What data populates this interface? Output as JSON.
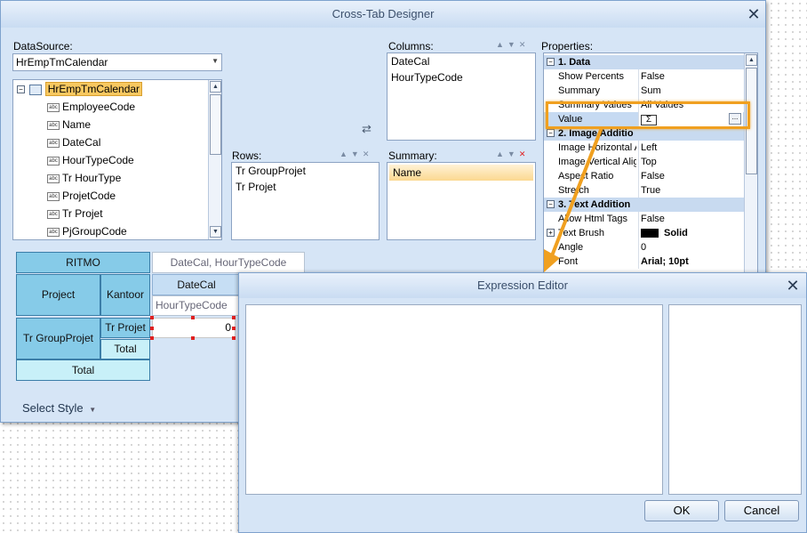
{
  "designer": {
    "title": "Cross-Tab Designer",
    "datasource_label": "DataSource:",
    "datasource_value": "HrEmpTmCalendar",
    "tree": {
      "root": "HrEmpTmCalendar",
      "fields": [
        "EmployeeCode",
        "Name",
        "DateCal",
        "HourTypeCode",
        "Tr HourType",
        "ProjetCode",
        "Tr Projet",
        "PjGroupCode"
      ]
    },
    "columns_label": "Columns:",
    "columns": [
      "DateCal",
      "HourTypeCode"
    ],
    "rows_label": "Rows:",
    "rows": [
      "Tr GroupProjet",
      "Tr Projet"
    ],
    "summary_label": "Summary:",
    "summary": [
      "Name"
    ],
    "properties_label": "Properties:",
    "select_style": "Select Style",
    "preview": {
      "title_cell": "RITMO",
      "header_cols": "DateCal, HourTypeCode",
      "col1": "Project",
      "col2": "Kantoor",
      "datecal": "DateCal",
      "hourtype": "HourTypeCode",
      "group": "Tr GroupProjet",
      "projet": "Tr Projet",
      "value": "0",
      "total_inner": "Total",
      "total_outer": "Total"
    }
  },
  "properties": {
    "cat1": "1. Data",
    "show_percents_name": "Show Percents",
    "show_percents_value": "False",
    "summary_name": "Summary",
    "summary_value": "Sum",
    "summary_values_name": "Summary Values",
    "summary_values_value": "All Values",
    "value_name": "Value",
    "value_value": "Σ",
    "cat2": "2. Image Additio",
    "img_h_name": "Image Horizontal A",
    "img_h_value": "Left",
    "img_v_name": "Image Vertical Alig",
    "img_v_value": "Top",
    "aspect_name": "Aspect Ratio",
    "aspect_value": "False",
    "stretch_name": "Stretch",
    "stretch_value": "True",
    "cat3": "3. Text Addition",
    "allow_html_name": "Allow Html Tags",
    "allow_html_value": "False",
    "text_brush_name": "Text Brush",
    "text_brush_value": "Solid",
    "angle_name": "Angle",
    "angle_value": "0",
    "font_name": "Font",
    "font_value": "Arial; 10pt"
  },
  "expression_editor": {
    "title": "Expression Editor",
    "ok": "OK",
    "cancel": "Cancel"
  },
  "colors": {
    "highlight": "#f0a020",
    "cell": "#86cbe8",
    "cell_light": "#c8f0f8"
  },
  "icons": [
    "close-icon",
    "dropdown-arrow-icon",
    "expand-minus-icon",
    "table-icon",
    "abc-field-icon",
    "swap-icon",
    "ellipsis-icon",
    "sigma-icon"
  ]
}
